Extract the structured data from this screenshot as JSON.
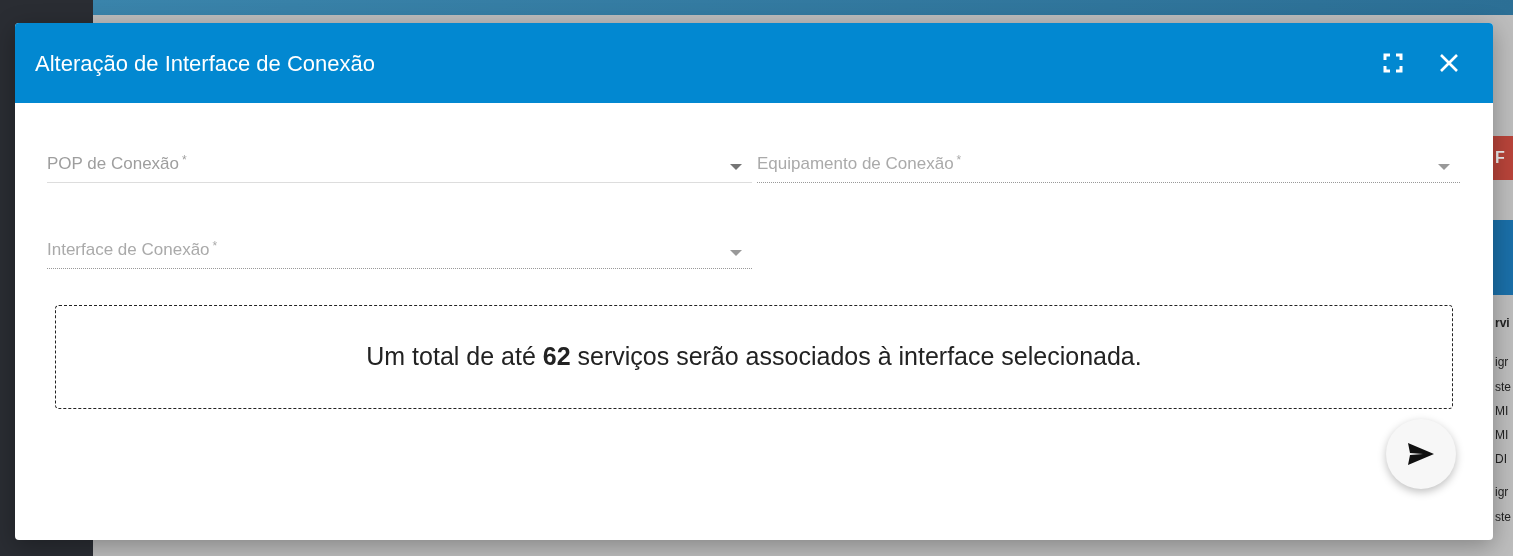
{
  "background": {
    "button": "F",
    "column_header": "rvi",
    "cells": [
      "igr",
      "ste",
      "MI",
      "MI",
      "DI",
      "igr",
      "ste"
    ]
  },
  "dialog": {
    "title": "Alteração de Interface de Conexão",
    "fields": [
      {
        "label": "POP de Conexão",
        "required_mark": "*",
        "disabled": false
      },
      {
        "label": "Equipamento de Conexão",
        "required_mark": "*",
        "disabled": true
      },
      {
        "label": "Interface de Conexão",
        "required_mark": "*",
        "disabled": true
      }
    ],
    "message": "Um total de até **62** serviços serão associados à interface selecionada."
  }
}
